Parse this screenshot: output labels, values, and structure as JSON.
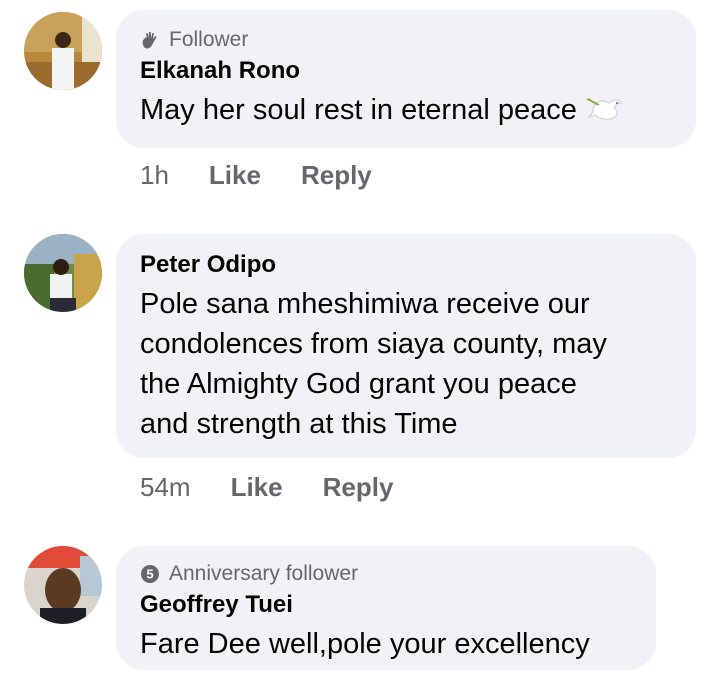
{
  "comments": [
    {
      "badge": "Follower",
      "badge_icon": "hand-wave-icon",
      "author": "Elkanah Rono",
      "text": "May her soul rest in eternal peace",
      "emoji": "dove-icon",
      "time": "1h",
      "like_label": "Like",
      "reply_label": "Reply"
    },
    {
      "author": "Peter Odipo",
      "text_lines": [
        "Pole sana mheshimiwa receive our",
        "condolences from siaya county, may",
        "the Almighty God grant you peace",
        "and strength at this Time"
      ],
      "time": "54m",
      "like_label": "Like",
      "reply_label": "Reply"
    },
    {
      "badge": "Anniversary follower",
      "badge_icon": "anniversary-5-icon",
      "author": "Geoffrey Tuei",
      "text": "Fare Dee well,pole your excellency"
    }
  ],
  "colors": {
    "bubble": "#f0f2f5",
    "secondary_text": "#65676b",
    "primary_text": "#050505"
  }
}
